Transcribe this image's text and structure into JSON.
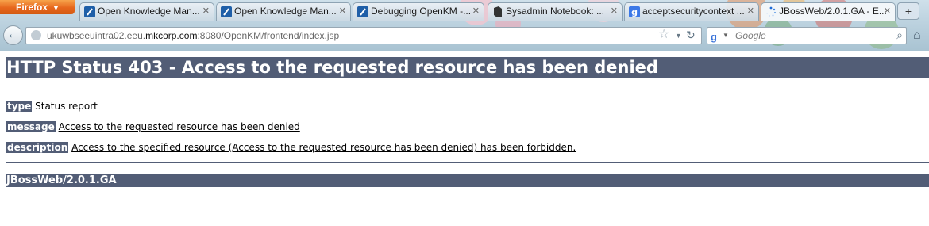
{
  "browser": {
    "menu_button": "Firefox",
    "tabs": [
      {
        "label": "Open Knowledge Man...",
        "icon": "openkm-icon",
        "active": false
      },
      {
        "label": "Open Knowledge Man...",
        "icon": "openkm-icon",
        "active": false
      },
      {
        "label": "Debugging OpenKM -...",
        "icon": "openkm-icon",
        "active": false
      },
      {
        "label": "Sysadmin Notebook: ...",
        "icon": "notebook-icon",
        "active": false
      },
      {
        "label": "acceptsecuritycontext ...",
        "icon": "google-icon",
        "active": false
      },
      {
        "label": "JBossWeb/2.0.1.GA - E...",
        "icon": "loading-icon",
        "active": true
      }
    ],
    "url_prefix": "ukuwbseeuintra02.eeu.",
    "url_domain": "mkcorp.com",
    "url_rest": ":8080/OpenKM/frontend/index.jsp",
    "search_placeholder": "Google"
  },
  "page": {
    "heading": "HTTP Status 403 - Access to the requested resource has been denied",
    "type_label": "type",
    "type_value": "Status report",
    "message_label": "message",
    "message_value": "Access to the requested resource has been denied",
    "description_label": "description",
    "description_value": "Access to the specified resource (Access to the requested resource has been denied) has been forbidden.",
    "footer": "JBossWeb/2.0.1.GA"
  },
  "colors": {
    "header_bar": "#525d76",
    "firefox_button": "#e6661c"
  }
}
